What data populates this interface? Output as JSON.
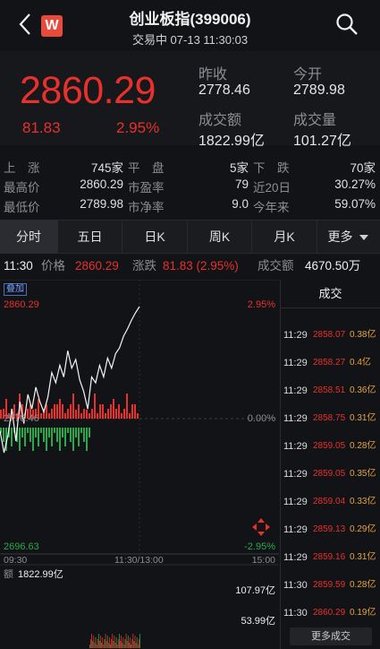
{
  "header": {
    "title": "创业板指(399006)",
    "subtitle": "交易中 07-13 11:30:03",
    "logo_letter": "W"
  },
  "quote": {
    "price": "2860.29",
    "change": "81.83",
    "change_pct": "2.95%",
    "prev_close_label": "昨收",
    "prev_close": "2778.46",
    "open_label": "今开",
    "open": "2789.98",
    "turnover_label": "成交额",
    "turnover": "1822.99亿",
    "volume_label": "成交量",
    "volume": "101.27亿"
  },
  "stats": {
    "rows": [
      [
        {
          "label": "上　涨",
          "value": "745家"
        },
        {
          "label": "平　盘",
          "value": "5家"
        },
        {
          "label": "下　跌",
          "value": "70家"
        }
      ],
      [
        {
          "label": "最高价",
          "value": "2860.29"
        },
        {
          "label": "市盈率",
          "value": "79"
        },
        {
          "label": "近20日",
          "value": "30.27%"
        }
      ],
      [
        {
          "label": "最低价",
          "value": "2789.98"
        },
        {
          "label": "市净率",
          "value": "9.0"
        },
        {
          "label": "今年来",
          "value": "59.07%"
        }
      ]
    ]
  },
  "tabs": [
    "分时",
    "五日",
    "日K",
    "周K",
    "月K",
    "更多"
  ],
  "info": {
    "time": "11:30",
    "price_label": "价格",
    "price": "2860.29",
    "change_label": "涨跌",
    "change": "81.83 (2.95%)",
    "turnover_label": "成交额",
    "turnover": "4670.50万"
  },
  "chart": {
    "badge": "叠加",
    "high": "2860.29",
    "high_pct": "2.95%",
    "mid": "2778.46",
    "mid_pct": "0.00%",
    "low": "2696.63",
    "low_pct": "-2.95%",
    "time_start": "09:30",
    "time_mid": "11:30/13:00",
    "time_end": "15:00",
    "vol_label": "额",
    "vol_total": "1822.99亿",
    "vol_max": "107.97亿",
    "vol_half": "53.99亿"
  },
  "chart_data": {
    "type": "line",
    "series": [
      {
        "values": [
          2775,
          2760,
          2772,
          2790,
          2768,
          2795,
          2780,
          2800,
          2790,
          2805,
          2795,
          2788,
          2798,
          2815,
          2808,
          2820,
          2812,
          2830,
          2818,
          2824,
          2810,
          2802,
          2790,
          2812,
          2808,
          2820,
          2812,
          2825,
          2818,
          2828,
          2832,
          2840,
          2845,
          2851,
          2856,
          2860.29
        ]
      }
    ],
    "ylim": [
      2696.63,
      2860.29
    ]
  },
  "trades": {
    "title": "成交",
    "more": "更多成交",
    "rows": [
      {
        "time": "11:29",
        "price": "2858.07",
        "pct": "0.38亿"
      },
      {
        "time": "11:29",
        "price": "2858.27",
        "pct": "0.4亿"
      },
      {
        "time": "11:29",
        "price": "2858.51",
        "pct": "0.36亿"
      },
      {
        "time": "11:29",
        "price": "2858.75",
        "pct": "0.31亿"
      },
      {
        "time": "11:29",
        "price": "2859.05",
        "pct": "0.28亿"
      },
      {
        "time": "11:29",
        "price": "2859.05",
        "pct": "0.35亿"
      },
      {
        "time": "11:29",
        "price": "2859.04",
        "pct": "0.33亿"
      },
      {
        "time": "11:29",
        "price": "2859.13",
        "pct": "0.29亿"
      },
      {
        "time": "11:29",
        "price": "2859.16",
        "pct": "0.31亿"
      },
      {
        "time": "11:30",
        "price": "2859.59",
        "pct": "0.28亿"
      },
      {
        "time": "11:30",
        "price": "2860.29",
        "pct": "0.19亿"
      }
    ]
  },
  "colors": {
    "up": "#e8302c",
    "down": "#2aa84a",
    "bg": "#121316"
  }
}
